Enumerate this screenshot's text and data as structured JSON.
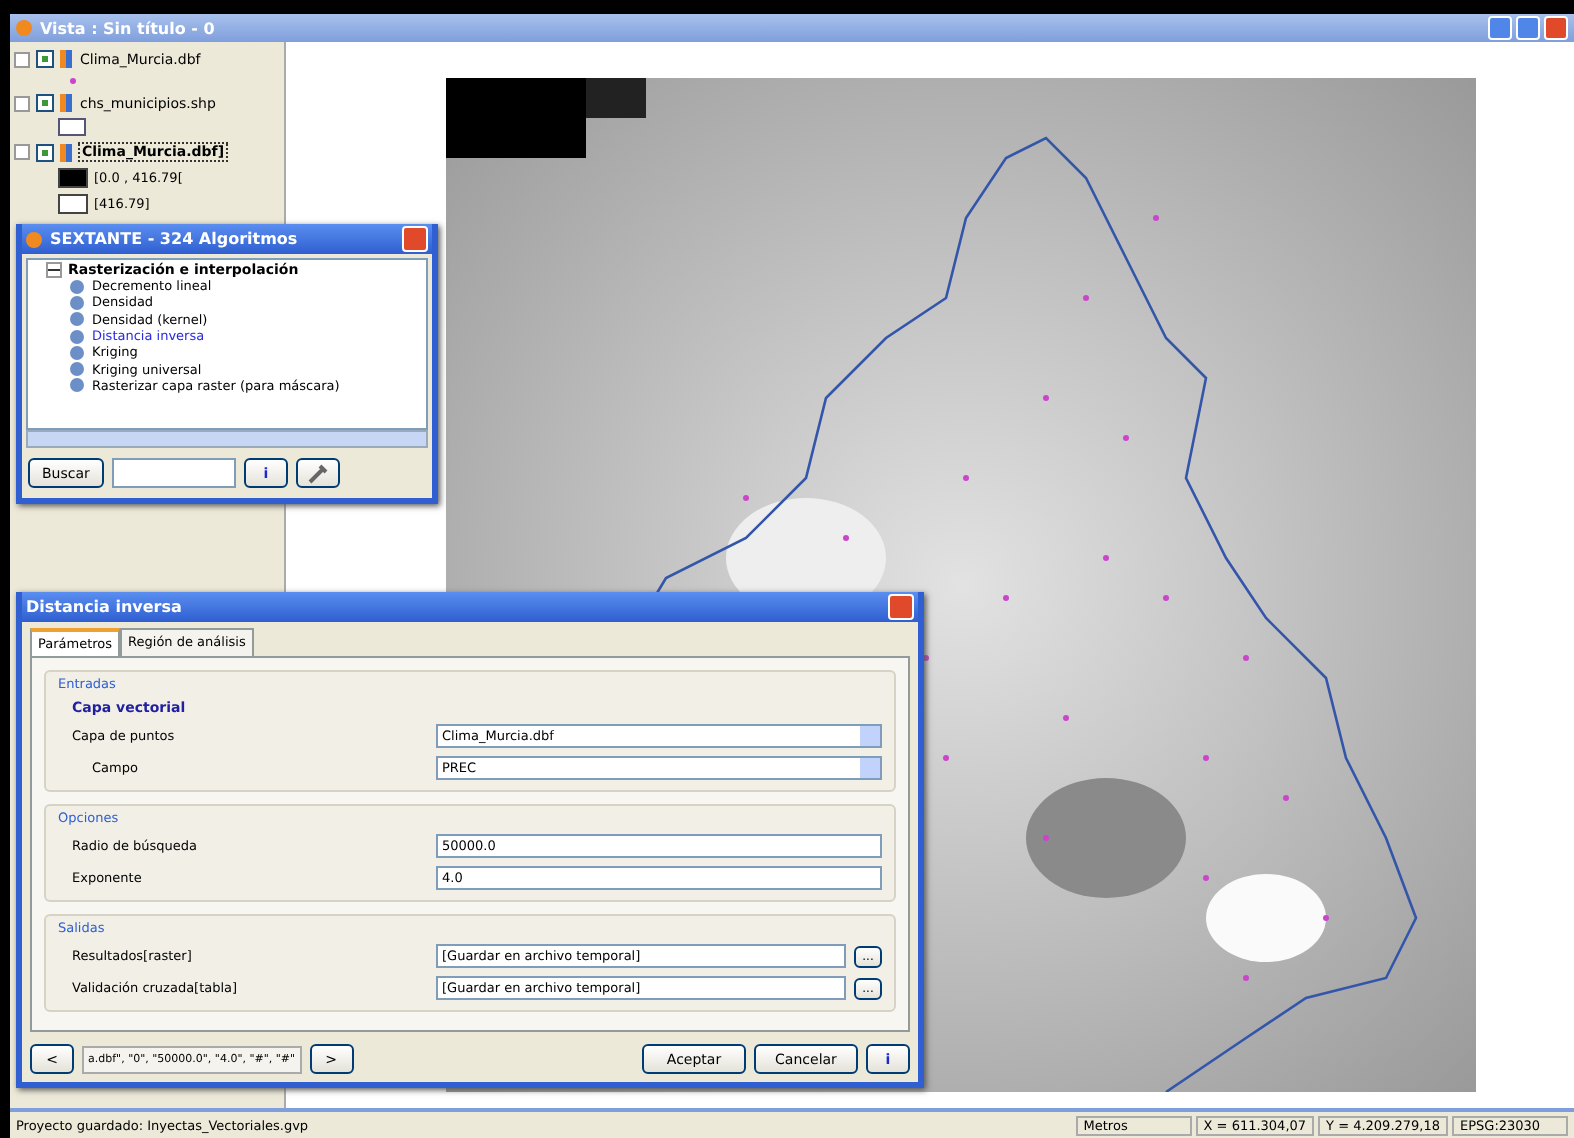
{
  "window": {
    "title": "Vista : Sin título - 0"
  },
  "toc": {
    "layers": [
      {
        "name": "Clima_Murcia.dbf",
        "checked": true,
        "selected": false,
        "legend": [
          {
            "kind": "point"
          }
        ]
      },
      {
        "name": "chs_municipios.shp",
        "checked": true,
        "selected": false,
        "legend": [
          {
            "kind": "polygon"
          }
        ]
      },
      {
        "name": "Clima_Murcia.dbf]",
        "checked": true,
        "selected": true,
        "legend": [
          {
            "kind": "swatch",
            "color": "#000000",
            "label": "[0.0 , 416.79["
          },
          {
            "kind": "swatch",
            "color": "#ffffff",
            "label": "[416.79]"
          }
        ]
      }
    ]
  },
  "toolbox": {
    "title": "SEXTANTE - 324 Algoritmos",
    "tree": [
      {
        "label": "Rasterización e interpolación",
        "expanded": true,
        "children": [
          {
            "label": "Decremento lineal",
            "selected": false
          },
          {
            "label": "Densidad",
            "selected": false
          },
          {
            "label": "Densidad (kernel)",
            "selected": false
          },
          {
            "label": "Distancia inversa",
            "selected": true
          },
          {
            "label": "Kriging",
            "selected": false
          },
          {
            "label": "Kriging universal",
            "selected": false
          },
          {
            "label": "Rasterizar capa raster (para máscara)",
            "selected": false
          }
        ]
      }
    ],
    "search_button": "Buscar",
    "info_button": "i"
  },
  "dialog": {
    "title": "Distancia inversa",
    "tabs": [
      {
        "label": "Parámetros",
        "selected": true
      },
      {
        "label": "Región de análisis",
        "selected": false
      }
    ],
    "sections": [
      {
        "title": "Entradas",
        "subtitle": "Capa vectorial",
        "rows": [
          {
            "kind": "select",
            "label": "Capa de puntos",
            "value": "Clima_Murcia.dbf",
            "indent": false
          },
          {
            "kind": "select",
            "label": "Campo",
            "value": "PREC",
            "indent": true
          }
        ]
      },
      {
        "title": "Opciones",
        "rows": [
          {
            "kind": "text",
            "label": "Radio de búsqueda",
            "value": "50000.0",
            "indent": false
          },
          {
            "kind": "text",
            "label": "Exponente",
            "value": "4.0",
            "indent": false
          }
        ]
      },
      {
        "title": "Salidas",
        "rows": [
          {
            "kind": "file",
            "label": "Resultados[raster]",
            "value": "[Guardar en archivo temporal]",
            "indent": false,
            "browse": "..."
          },
          {
            "kind": "file",
            "label": "Validación cruzada[tabla]",
            "value": "[Guardar en archivo temporal]",
            "indent": false,
            "browse": "..."
          }
        ]
      }
    ],
    "prev_button": "<",
    "command": "a.dbf\", \"0\", \"50000.0\", \"4.0\", \"#\", \"#\"",
    "next_button": ">",
    "ok_button": "Aceptar",
    "cancel_button": "Cancelar",
    "info_button": "i"
  },
  "status_bar": {
    "message": "Proyecto guardado: Inyectas_Vectoriales.gvp",
    "units": "Metros",
    "x": "X = 611.304,07",
    "y": "Y = 4.209.279,18",
    "crs": "EPSG:23030"
  }
}
